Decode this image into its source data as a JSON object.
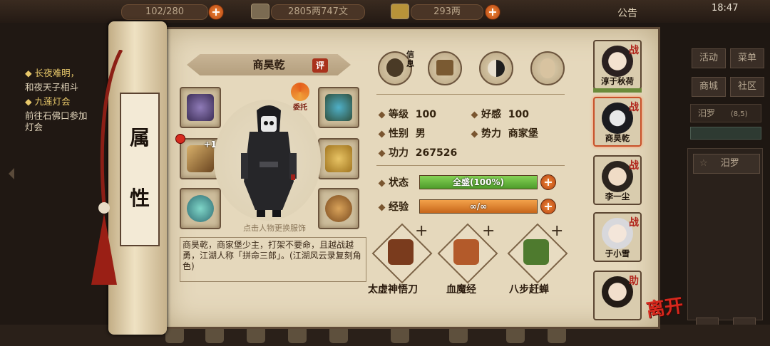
{
  "top_bar": {
    "stamina": "102/280",
    "money": "2805两747文",
    "ingot": "293两",
    "announcement": "公告",
    "clock": "18:47"
  },
  "quests": [
    {
      "text": "长夜难明，",
      "highlight": true
    },
    {
      "text": "和夜天子相斗",
      "highlight": false
    },
    {
      "text": "九莲灯会",
      "highlight": true
    },
    {
      "text": "前往石佛口参加",
      "highlight": false
    },
    {
      "text": "灯会",
      "highlight": false
    }
  ],
  "scroll_title": [
    "属",
    "性"
  ],
  "character": {
    "name": "商昊乾",
    "review_label": "评",
    "delegate_label": "委托",
    "hint": "点击人物更换服饰",
    "description": "商昊乾，商家堡少主，打架不要命，且越战越勇，江湖人称「拼命三郎」。(江湖风云录复刻角色)",
    "weapon_level": "+1"
  },
  "tabs": [
    {
      "name": "info",
      "label": "信息"
    },
    {
      "name": "inventory",
      "label": ""
    },
    {
      "name": "bagua",
      "label": ""
    },
    {
      "name": "meridian",
      "label": ""
    }
  ],
  "stats": {
    "level_label": "等级",
    "level": "100",
    "favor_label": "好感",
    "favor": "100",
    "gender_label": "性别",
    "gender": "男",
    "faction_label": "势力",
    "faction": "商家堡",
    "power_label": "功力",
    "power": "267526",
    "status_label": "状态",
    "status_text": "全盛(100%)",
    "status_fill": 1.0,
    "exp_label": "经验",
    "exp_text": "∞/∞",
    "exp_fill": 1.0
  },
  "skills": [
    {
      "name": "太虚神悟刀",
      "color": "#7a3b1d"
    },
    {
      "name": "血魔经",
      "color": "#b35a2a"
    },
    {
      "name": "八步赶蝉",
      "color": "#4e7a2e"
    }
  ],
  "party": [
    {
      "name": "淳于秋荷",
      "badge": "战"
    },
    {
      "name": "商昊乾",
      "badge": "战"
    },
    {
      "name": "李一尘",
      "badge": "战"
    },
    {
      "name": "于小雪",
      "badge": "战"
    },
    {
      "name": "",
      "badge": "助"
    }
  ],
  "leave_label": "离开",
  "right_menu": {
    "activity": "活动",
    "menu": "菜单",
    "shop": "商城",
    "community": "社区",
    "location": "汨罗",
    "coords": "(8,5)",
    "map_item": "汨罗"
  },
  "colors": {
    "status_bar": "#5ea834",
    "exp_bar": "#d9781e",
    "accent_red": "#b1241b"
  }
}
